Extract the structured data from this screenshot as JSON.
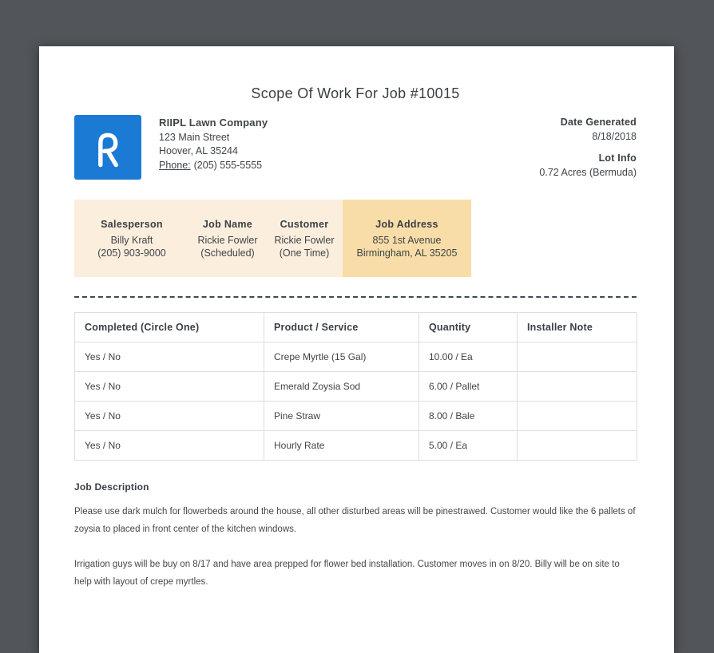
{
  "document": {
    "title": "Scope Of Work For Job #10015"
  },
  "company": {
    "logo_letter": "R",
    "name": "RIIPL Lawn Company",
    "address_line1": "123 Main Street",
    "address_line2": "Hoover, AL 35244",
    "phone_label": "Phone:",
    "phone_number": "(205) 555-5555"
  },
  "meta": {
    "date_generated_label": "Date Generated",
    "date_generated": "8/18/2018",
    "lot_info_label": "Lot Info",
    "lot_info": "0.72 Acres (Bermuda)"
  },
  "job_summary": {
    "columns": [
      {
        "label": "Salesperson",
        "line1": "Billy Kraft",
        "line2": "(205) 903-9000"
      },
      {
        "label": "Job Name",
        "line1": "Rickie Fowler",
        "line2": "(Scheduled)"
      },
      {
        "label": "Customer",
        "line1": "Rickie Fowler",
        "line2": "(One Time)"
      },
      {
        "label": "Job Address",
        "line1": "855 1st Avenue",
        "line2": "Birmingham, AL 35205"
      }
    ]
  },
  "work_table": {
    "headers": [
      "Completed (Circle One)",
      "Product / Service",
      "Quantity",
      "Installer Note"
    ],
    "rows": [
      [
        "Yes / No",
        "Crepe Myrtle (15 Gal)",
        "10.00 / Ea",
        ""
      ],
      [
        "Yes / No",
        "Emerald Zoysia Sod",
        "6.00 / Pallet",
        ""
      ],
      [
        "Yes / No",
        "Pine Straw",
        "8.00 / Bale",
        ""
      ],
      [
        "Yes / No",
        "Hourly Rate",
        "5.00 / Ea",
        ""
      ]
    ]
  },
  "job_description": {
    "heading": "Job Description",
    "paragraphs": [
      "Please use dark mulch for flowerbeds around the house, all other disturbed areas will be pinestrawed. Customer would like the 6 pallets of zoysia to placed in front center of the kitchen windows.",
      "Irrigation guys will be buy on 8/17 and have area prepped for flower bed installation. Customer moves in on 8/20. Billy will be on site to help with layout of crepe myrtles."
    ]
  },
  "colors": {
    "canvas_background": "#52565b",
    "logo_blue": "#1b7ad3",
    "highlight_light": "#fceedd",
    "highlight_strong": "#f8dda8",
    "dashed_divider": "#3b4a59"
  }
}
